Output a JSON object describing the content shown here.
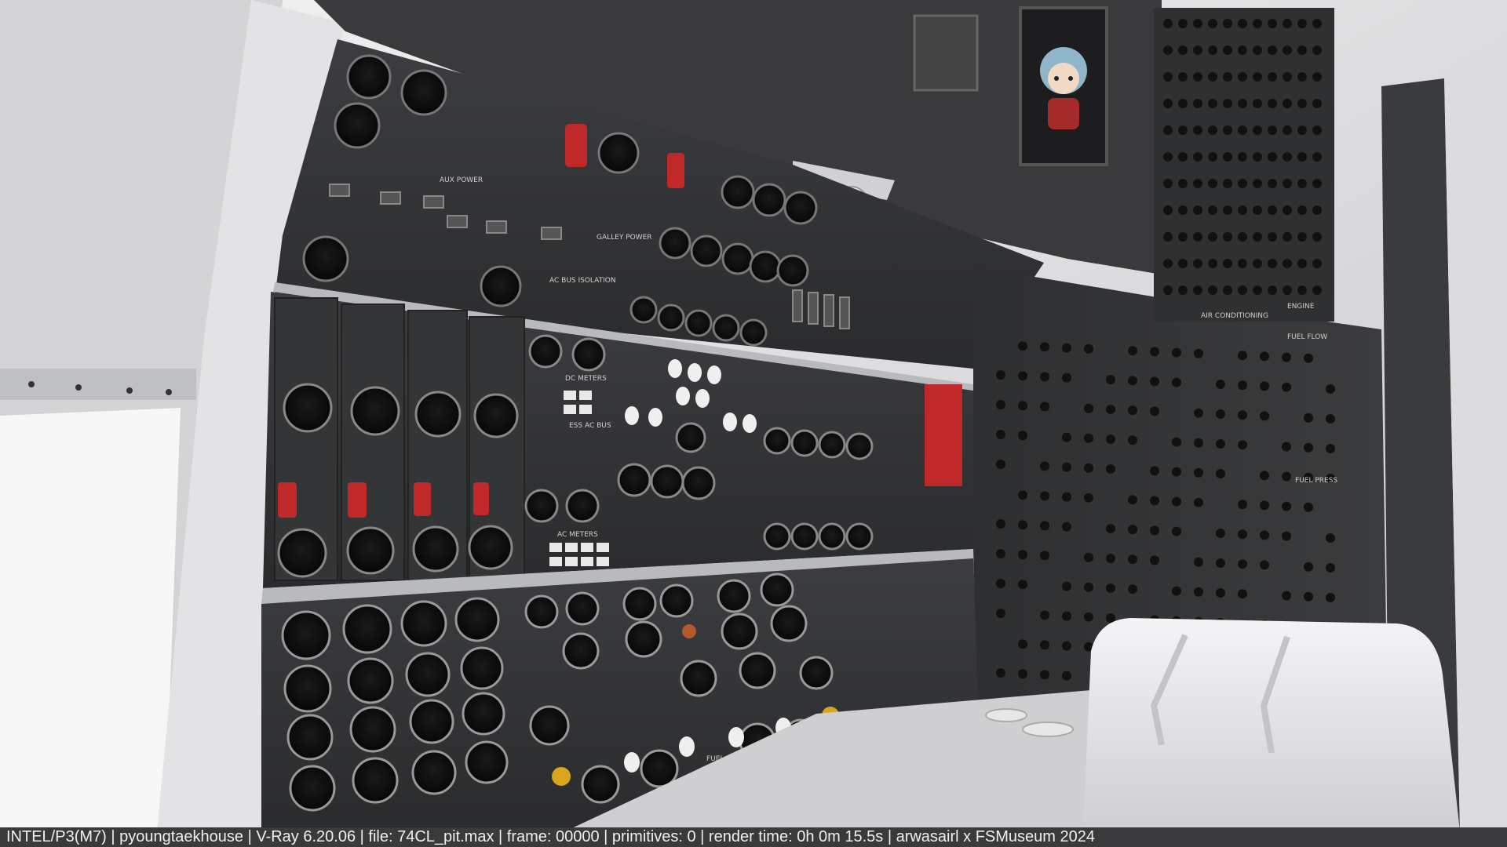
{
  "scene": {
    "description_free": true,
    "colors": {
      "panel_dark": "#2b2c2e",
      "panel_mid": "#3a3b3d",
      "ceiling_white": "#e6e6e8",
      "seat_white": "#ececee",
      "warning_red": "#c0282a",
      "knob_yellow": "#d9a51a"
    },
    "labels": {
      "aux_power": "AUX POWER",
      "galley_power": "GALLEY POWER",
      "ac_bus_isolation": "AC BUS ISOLATION",
      "dc_meters": "DC METERS",
      "ess_ac_bus": "ESS AC BUS",
      "ac_meters": "AC METERS",
      "fuel_control": "FUEL CONTROL",
      "air_conditioning": "AIR CONDITIONING",
      "engine": "ENGINE",
      "fuel_flow": "FUEL FLOW",
      "fuel_press": "FUEL PRESS"
    }
  },
  "status_bar": {
    "text": "INTEL/P3(M7) | pyoungtaekhouse | V-Ray 6.20.06 | file: 74CL_pit.max | frame: 00000 | primitives: 0 | render time:  0h  0m 15.5s | arwasairl x FSMuseum 2024"
  }
}
